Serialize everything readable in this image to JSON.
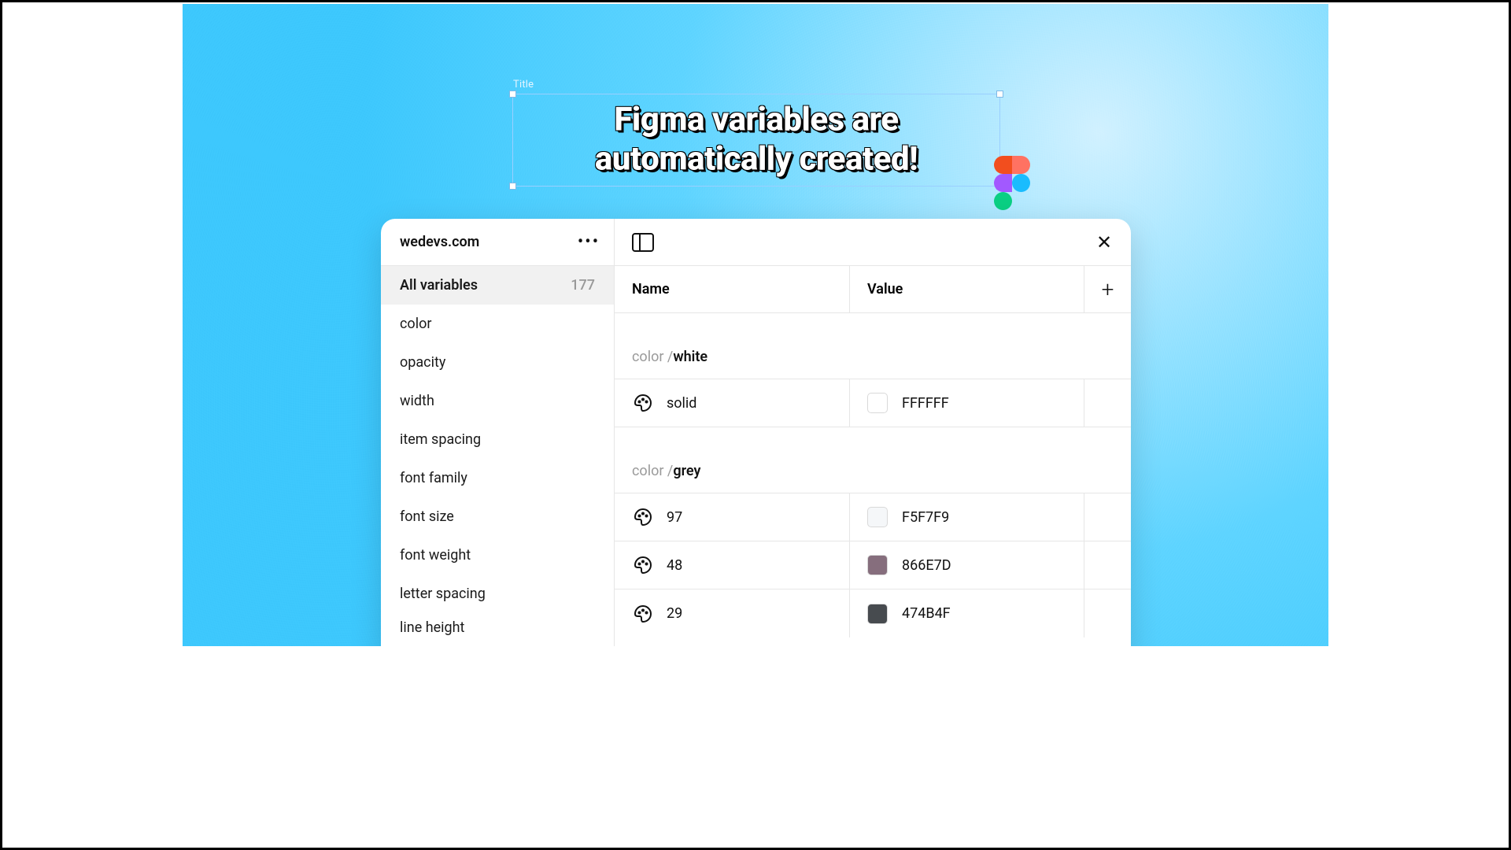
{
  "selection": {
    "label": "Title",
    "title_text": "Figma variables are\nautomatically created!"
  },
  "panel": {
    "collection_name": "wedevs.com",
    "columns": {
      "name": "Name",
      "value": "Value"
    },
    "sidebar": {
      "all_label": "All variables",
      "all_count": "177",
      "categories": [
        "color",
        "opacity",
        "width",
        "item spacing",
        "font family",
        "font size",
        "font weight",
        "letter spacing",
        "line height"
      ]
    },
    "groups": [
      {
        "prefix": "color / ",
        "name": "white",
        "rows": [
          {
            "name": "solid",
            "hex": "FFFFFF",
            "swatch": "#FFFFFF"
          }
        ]
      },
      {
        "prefix": "color / ",
        "name": "grey",
        "rows": [
          {
            "name": "97",
            "hex": "F5F7F9",
            "swatch": "#F5F7F9"
          },
          {
            "name": "48",
            "hex": "866E7D",
            "swatch": "#866E7D"
          },
          {
            "name": "29",
            "hex": "474B4F",
            "swatch": "#474B4F"
          }
        ]
      }
    ]
  }
}
